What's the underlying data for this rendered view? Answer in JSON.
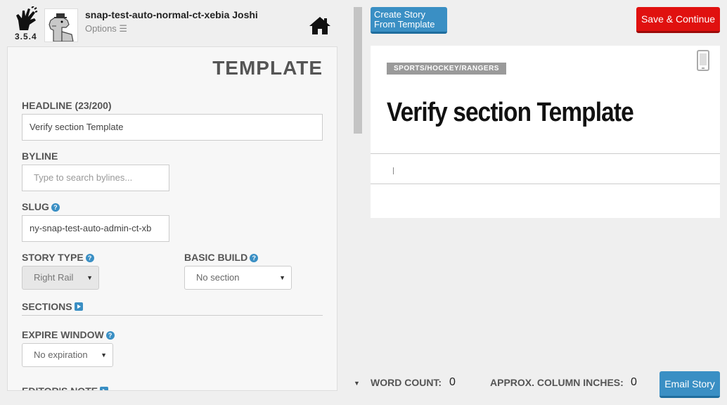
{
  "app": {
    "version": "3.5.4",
    "user_name": "snap-test-auto-normal-ct-xebia Joshi",
    "options_label": "Options ☰"
  },
  "panel": {
    "title": "TEMPLATE",
    "headline": {
      "label": "HEADLINE (23/200)",
      "value": "Verify section Template"
    },
    "byline": {
      "label": "BYLINE",
      "placeholder": "Type to search bylines..."
    },
    "slug": {
      "label": "SLUG",
      "value": "ny-snap-test-auto-admin-ct-xb"
    },
    "story_type": {
      "label": "STORY TYPE",
      "value": "Right Rail"
    },
    "basic_build": {
      "label": "BASIC BUILD",
      "value": "No section"
    },
    "sections": {
      "label": "SECTIONS"
    },
    "expire_window": {
      "label": "EXPIRE WINDOW",
      "value": "No expiration"
    },
    "editors_note": {
      "label": "EDITOR'S NOTE"
    }
  },
  "toolbar": {
    "template_button": "Create Story From Template",
    "save_button": "Save & Continue",
    "email_button": "Email Story"
  },
  "preview": {
    "section_tag": "SPORTS/HOCKEY/RANGERS",
    "headline": "Verify section Template"
  },
  "stats": {
    "word_count_label": "WORD COUNT:",
    "word_count": "0",
    "column_inches_label": "APPROX. COLUMN INCHES:",
    "column_inches": "0"
  },
  "colors": {
    "accent_blue": "#3a8fc4",
    "save_red": "#e0110f"
  }
}
